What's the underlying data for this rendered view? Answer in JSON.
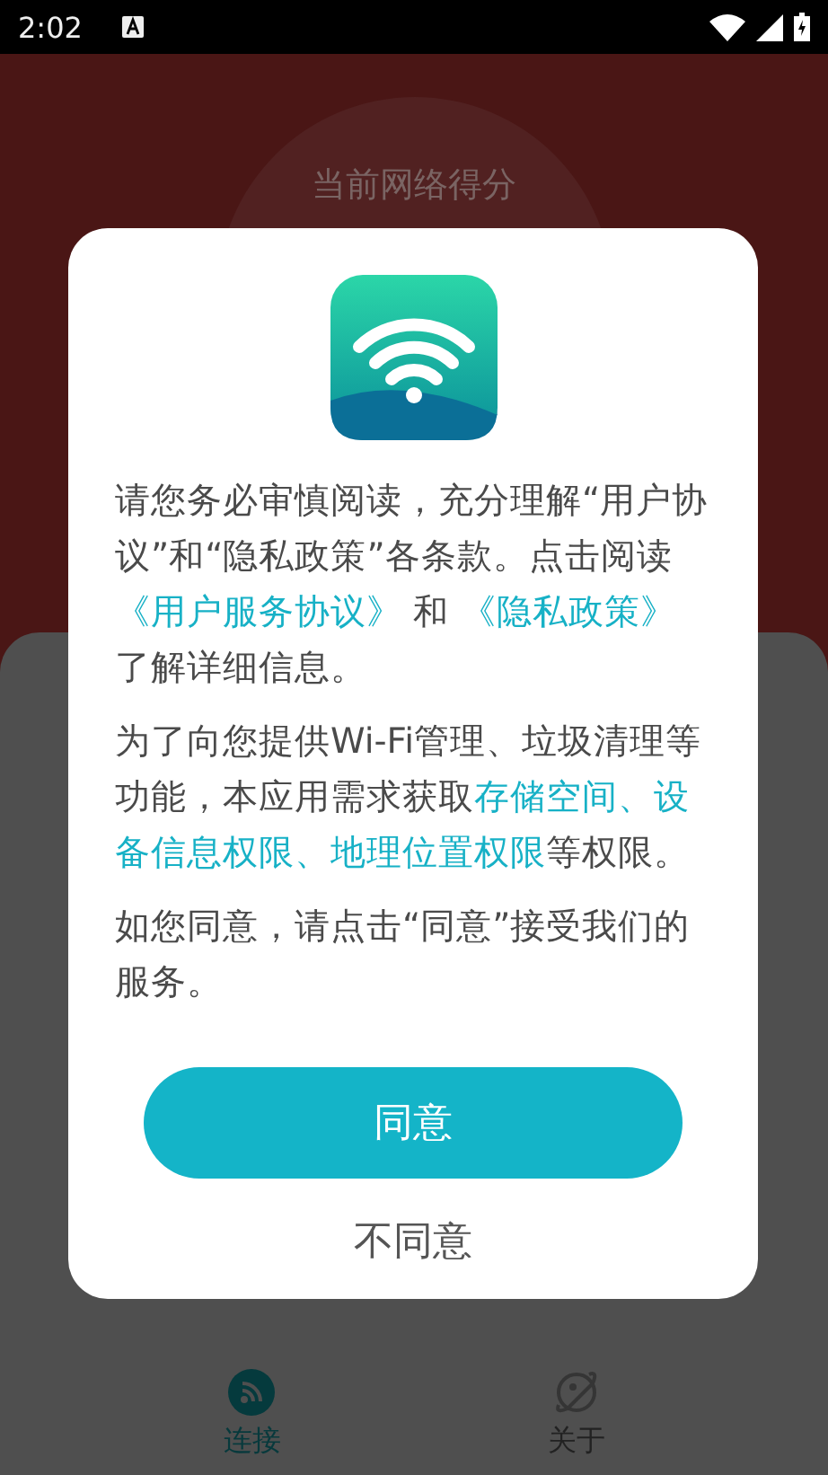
{
  "status_bar": {
    "time": "2:02"
  },
  "background": {
    "score_title": "当前网络得分"
  },
  "bottom_nav": [
    {
      "label": "连接",
      "selected": true,
      "kind": "connect"
    },
    {
      "label": "关于",
      "selected": false,
      "kind": "about"
    }
  ],
  "dialog": {
    "paragraphs": [
      {
        "parts": [
          {
            "text": "请您务必审慎阅读，充分理解“用户协议”和“隐私政策”各条款。点击阅读",
            "kind": "text"
          },
          {
            "text": "《用户服务协议》",
            "kind": "link"
          },
          {
            "text": " 和 ",
            "kind": "text"
          },
          {
            "text": "《隐私政策》",
            "kind": "link"
          },
          {
            "text": "了解详细信息。",
            "kind": "text"
          }
        ]
      },
      {
        "parts": [
          {
            "text": "为了向您提供Wi-Fi管理、垃圾清理等功能，本应用需求获取",
            "kind": "text"
          },
          {
            "text": "存储空间、设",
            "kind": "highlight"
          },
          {
            "text": "备信息权限、地理位置权限",
            "kind": "highlight"
          },
          {
            "text": "等权限。",
            "kind": "text"
          }
        ]
      },
      {
        "parts": [
          {
            "text": "如您同意，请点击“同意”接受我们的服务。",
            "kind": "text"
          }
        ]
      }
    ],
    "agree_button": "同意",
    "disagree_button": "不同意"
  }
}
